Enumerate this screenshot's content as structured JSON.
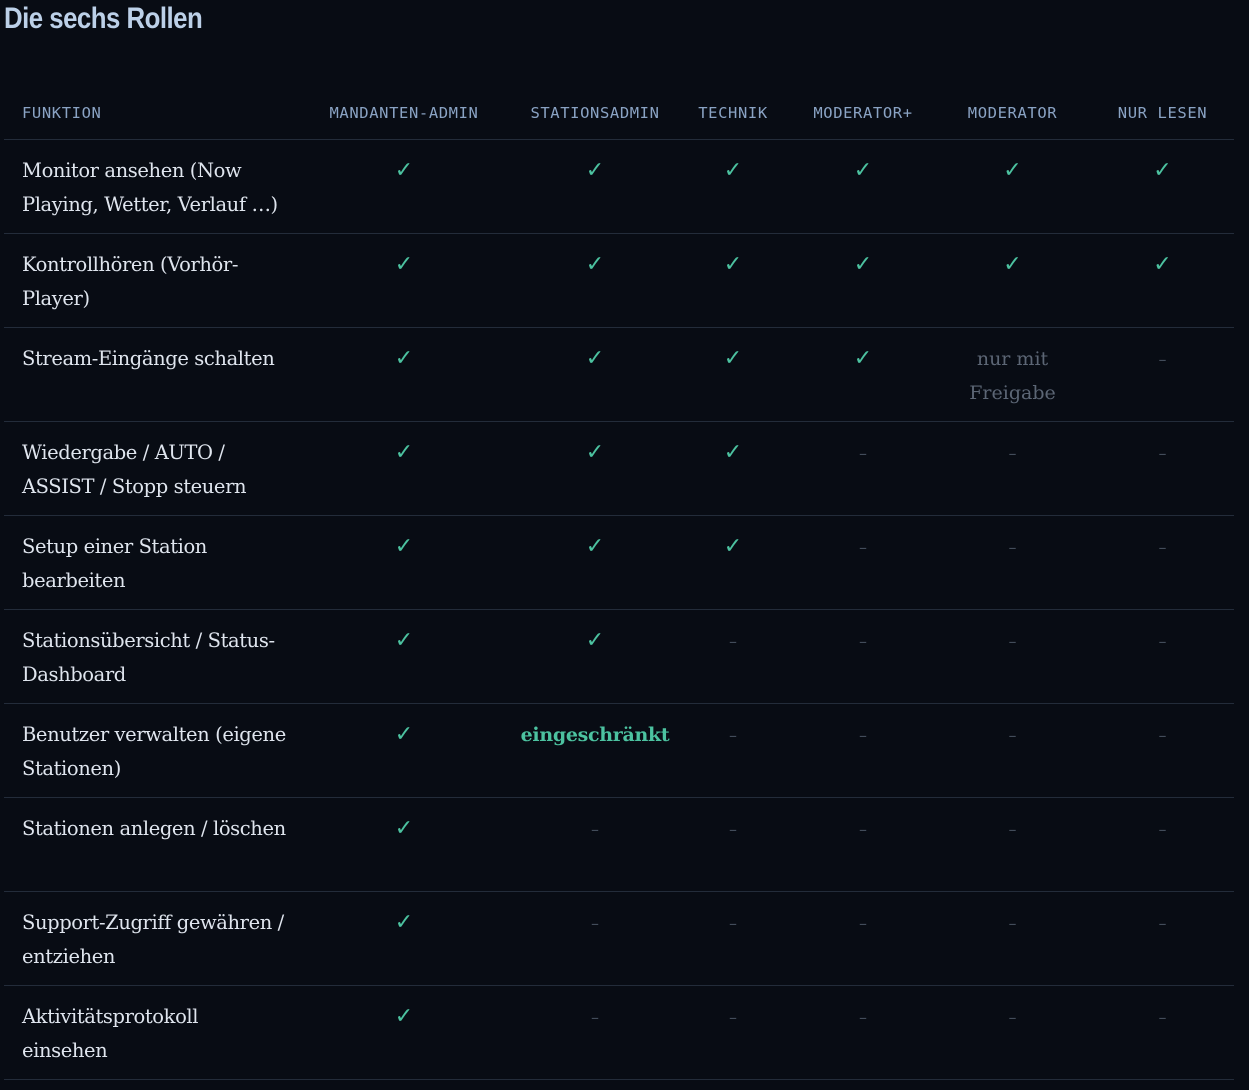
{
  "page": {
    "title": "Die sechs Rollen"
  },
  "table": {
    "headers": [
      "FUNKTION",
      "MANDANTEN-ADMIN",
      "STATIONSADMIN",
      "TECHNIK",
      "MODERATOR+",
      "MODERATOR",
      "NUR LESEN"
    ],
    "marks": {
      "yes": "✓",
      "no": "–"
    },
    "rows": [
      {
        "function": "Monitor ansehen (Now Playing, Wetter, Verlauf …)",
        "cells": [
          "yes",
          "yes",
          "yes",
          "yes",
          "yes",
          "yes"
        ]
      },
      {
        "function": "Kontrollhören (Vorhör-Player)",
        "cells": [
          "yes",
          "yes",
          "yes",
          "yes",
          "yes",
          "yes"
        ]
      },
      {
        "function": "Stream-Eingänge schalten",
        "cells": [
          "yes",
          "yes",
          "yes",
          "yes",
          "nur mit Freigabe",
          "no"
        ]
      },
      {
        "function": "Wiedergabe / AUTO / ASSIST / Stopp steuern",
        "cells": [
          "yes",
          "yes",
          "yes",
          "no",
          "no",
          "no"
        ]
      },
      {
        "function": "Setup einer Station bearbeiten",
        "cells": [
          "yes",
          "yes",
          "yes",
          "no",
          "no",
          "no"
        ]
      },
      {
        "function": "Stationsübersicht / Status-Dashboard",
        "cells": [
          "yes",
          "yes",
          "no",
          "no",
          "no",
          "no"
        ]
      },
      {
        "function": "Benutzer verwalten (eigene Stationen)",
        "cells": [
          "yes",
          "eingeschränkt",
          "no",
          "no",
          "no",
          "no"
        ]
      },
      {
        "function": "Stationen anlegen / löschen",
        "cells": [
          "yes",
          "no",
          "no",
          "no",
          "no",
          "no"
        ]
      },
      {
        "function": "Support-Zugriff gewähren / entziehen",
        "cells": [
          "yes",
          "no",
          "no",
          "no",
          "no",
          "no"
        ]
      },
      {
        "function": "Aktivitätsprotokoll einsehen",
        "cells": [
          "yes",
          "no",
          "no",
          "no",
          "no",
          "no"
        ]
      }
    ]
  },
  "colors": {
    "background": "#080c14",
    "title": "#bcd0e8",
    "header_text": "#8aa3c4",
    "row_text": "#dfe5ee",
    "check": "#4cc2a0",
    "dash": "#424c5a",
    "muted_text": "#5c6675",
    "divider": "#232c3a"
  }
}
